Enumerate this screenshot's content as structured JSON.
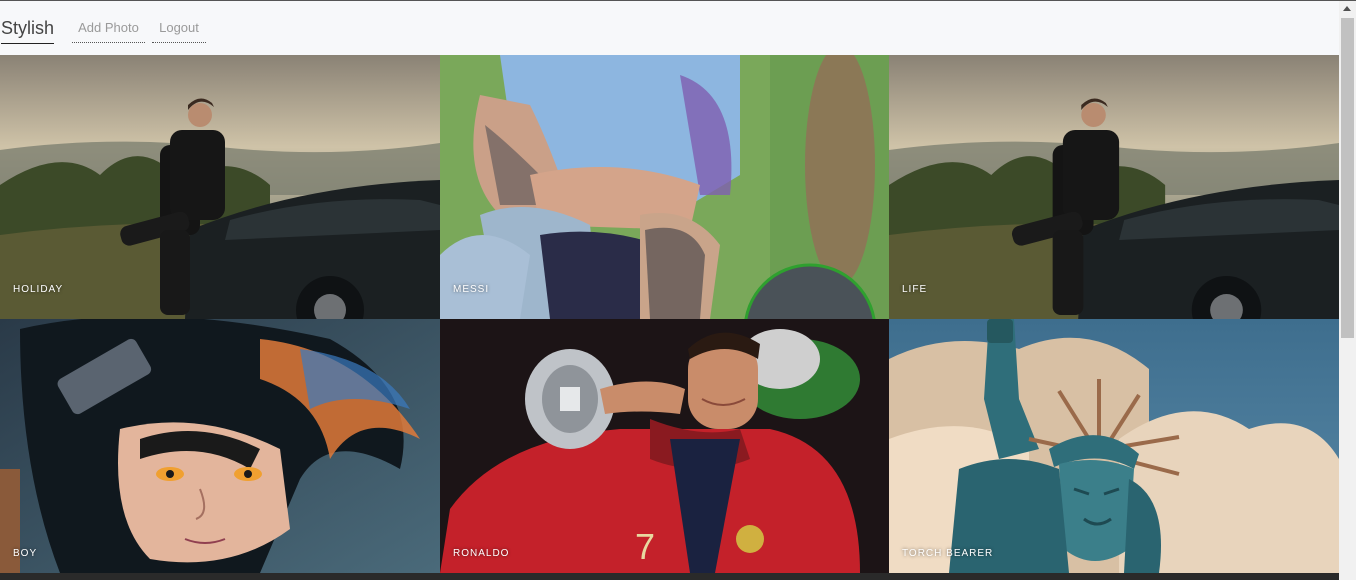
{
  "navbar": {
    "brand": "Stylish",
    "links": [
      {
        "label": "Add Photo"
      },
      {
        "label": "Logout"
      }
    ]
  },
  "gallery": {
    "photos": [
      {
        "caption": "HOLIDAY",
        "subject": "man-leaning-on-car-landscape"
      },
      {
        "caption": "MESSI",
        "subject": "footballer-kneeling-light-blue-kit"
      },
      {
        "caption": "LIFE",
        "subject": "man-leaning-on-car-landscape"
      },
      {
        "caption": "BOY",
        "subject": "anime-boy-wild-hair"
      },
      {
        "caption": "RONALDO",
        "subject": "footballer-holding-trophy-red-kit"
      },
      {
        "caption": "TORCH BEARER",
        "subject": "statue-of-liberty-clouds"
      }
    ]
  },
  "colors": {
    "navbar_bg": "#f7f8fa",
    "caption_text": "#ffffff",
    "brand_text": "#444444",
    "link_text": "#9a9a9a"
  }
}
